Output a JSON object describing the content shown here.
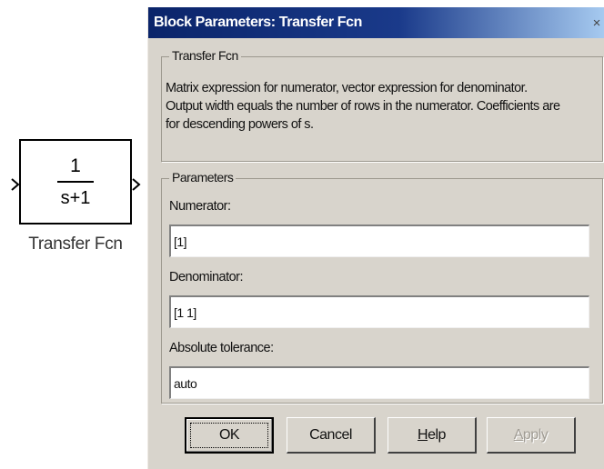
{
  "block": {
    "numerator": "1",
    "denominator": "s+1",
    "name": "Transfer Fcn"
  },
  "dialog": {
    "title": "Block Parameters: Transfer Fcn",
    "close_glyph": "×",
    "description_group": {
      "legend": "Transfer Fcn",
      "lines": [
        "Matrix expression for numerator, vector expression for denominator.",
        "Output width equals the number of rows in the numerator.  Coefficients are",
        "for descending powers of s."
      ]
    },
    "parameters_group": {
      "legend": "Parameters",
      "fields": [
        {
          "label": "Numerator:",
          "value": "[1]"
        },
        {
          "label": "Denominator:",
          "value": "[1 1]"
        },
        {
          "label": "Absolute tolerance:",
          "value": "auto"
        }
      ]
    },
    "buttons": {
      "ok": "OK",
      "cancel": "Cancel",
      "help": "Help",
      "apply": "Apply"
    }
  },
  "colors": {
    "titlebar_start": "#0a246a",
    "titlebar_end": "#a6caf0",
    "dialog_face": "#d8d4cc"
  }
}
